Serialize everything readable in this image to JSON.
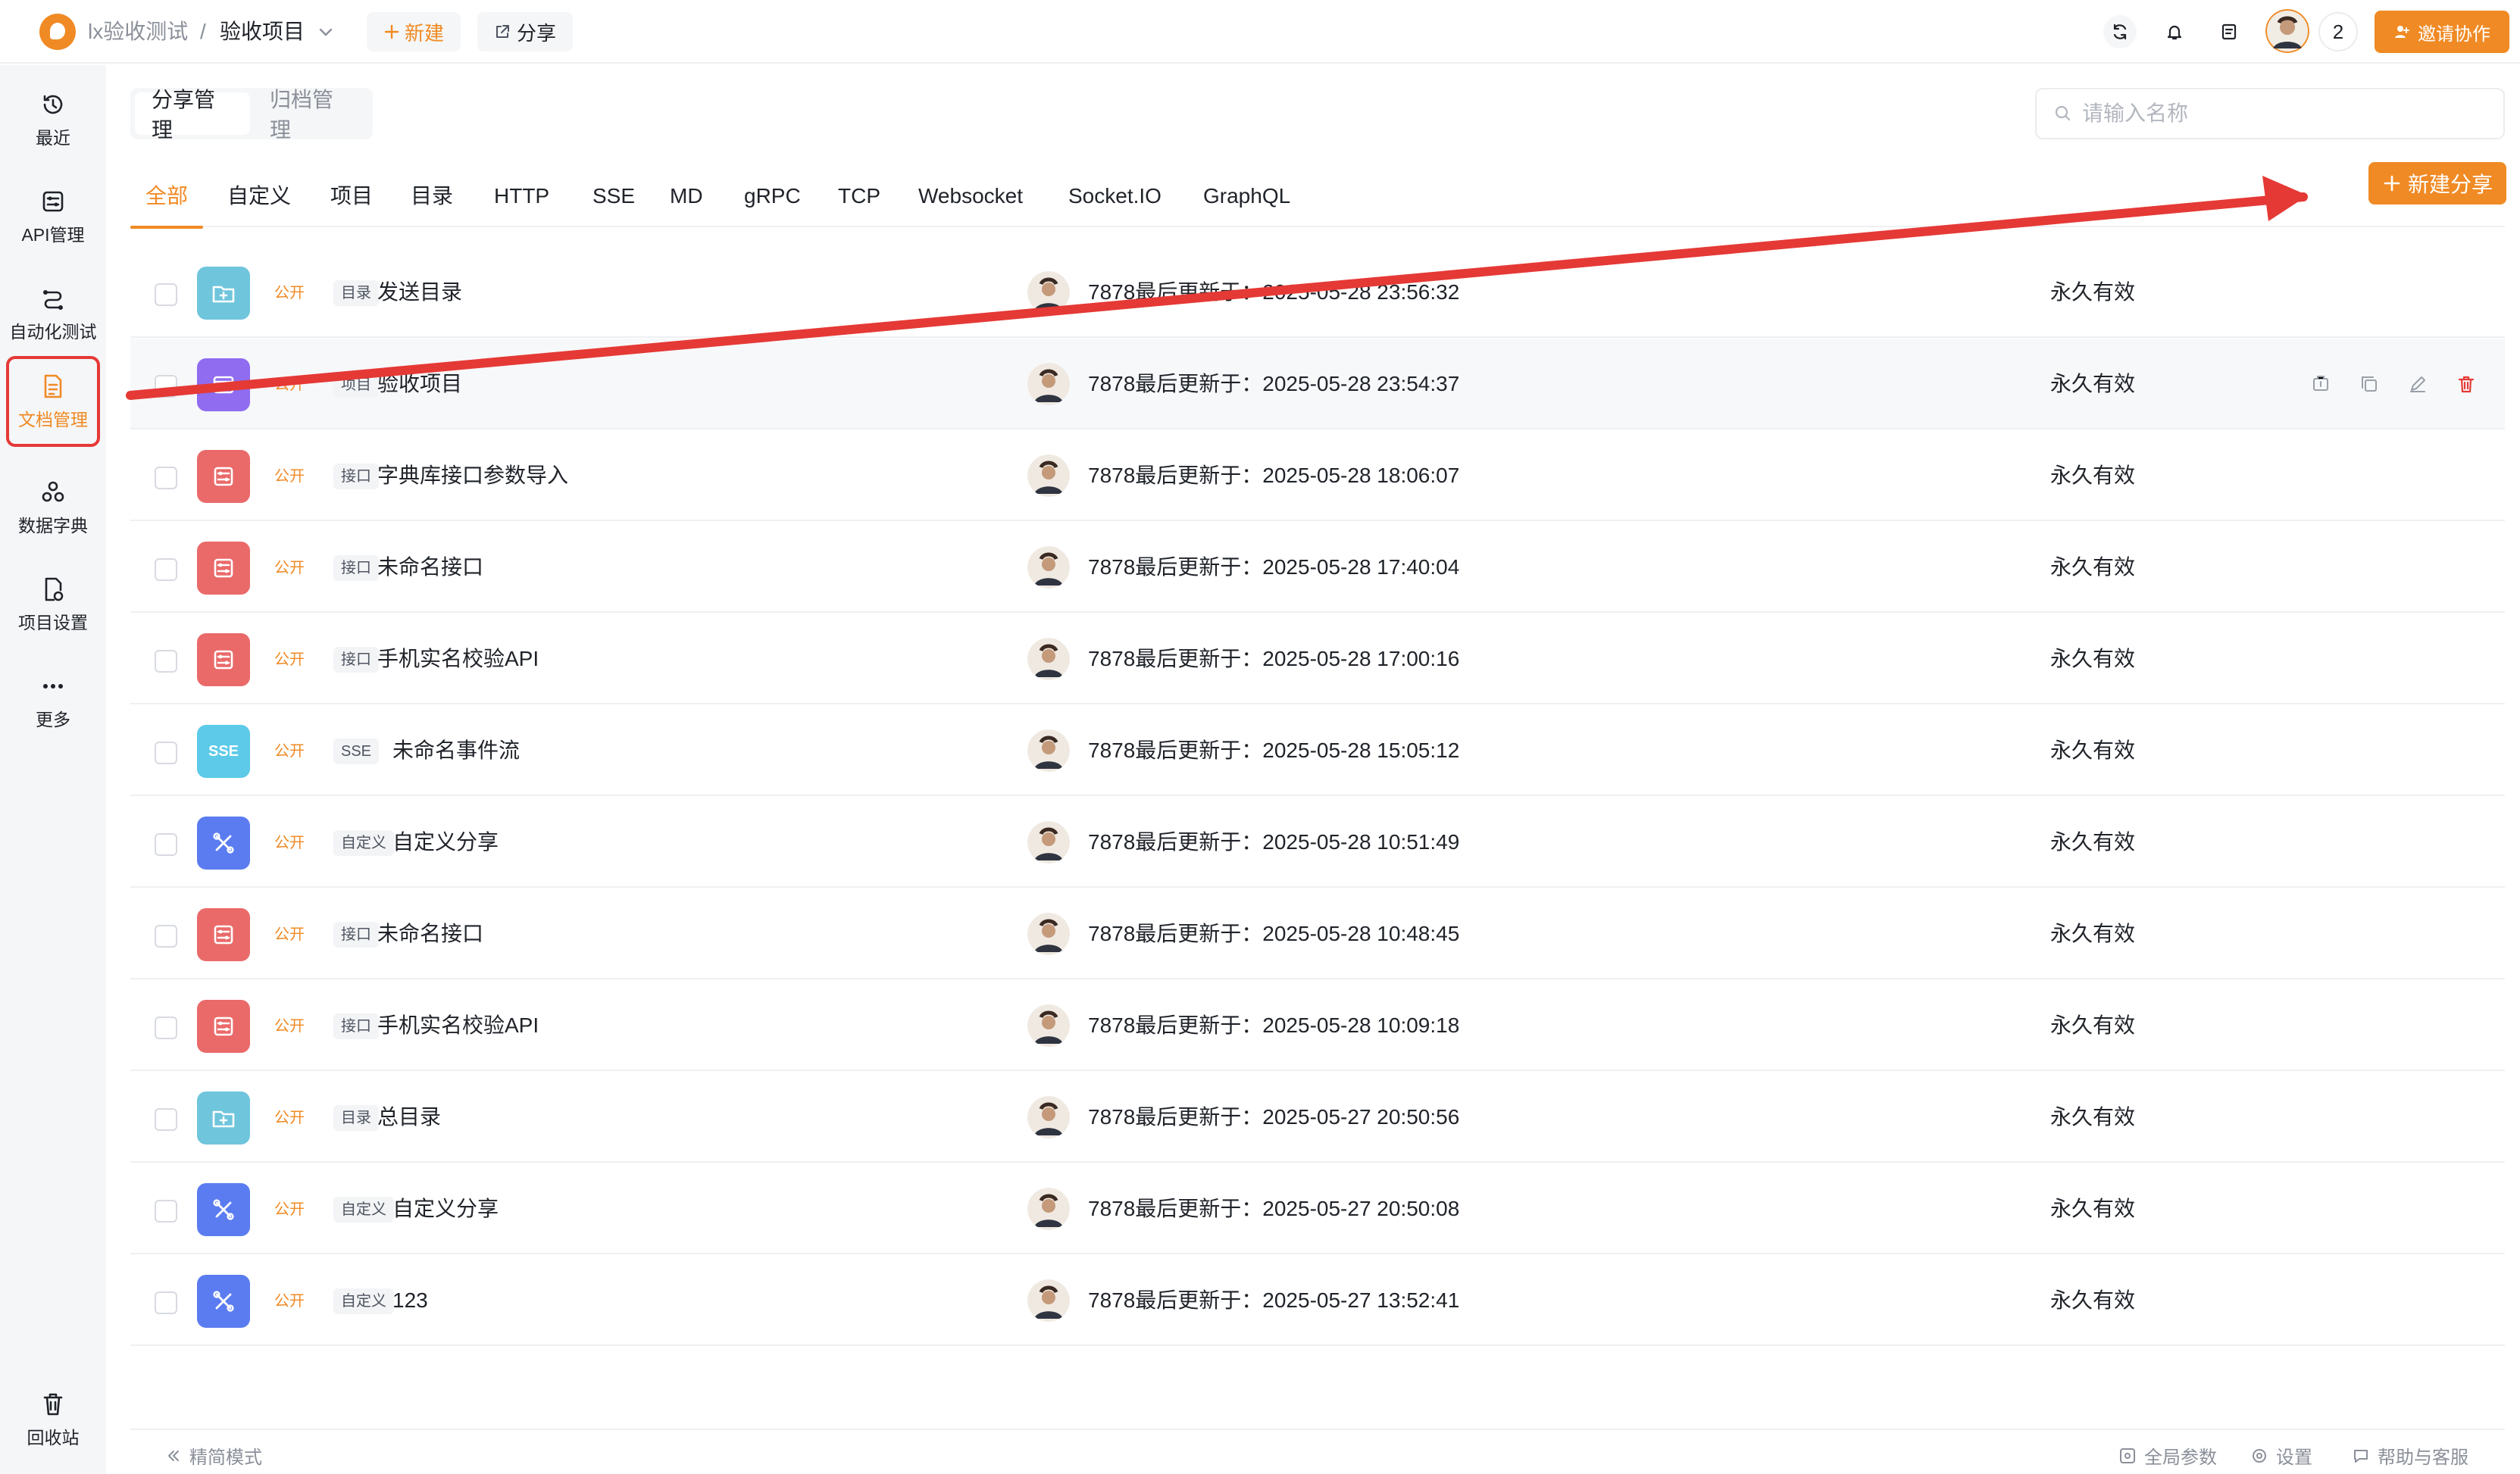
{
  "topbar": {
    "workspace": "lx验收测试",
    "separator": "/",
    "project": "验收项目",
    "new_label": "新建",
    "share_label": "分享",
    "member_count": "2",
    "invite_label": "邀请协作"
  },
  "sidebar": {
    "items": [
      {
        "label": "最近",
        "icon": "history-icon"
      },
      {
        "label": "API管理",
        "icon": "api-icon"
      },
      {
        "label": "自动化测试",
        "icon": "automation-icon"
      },
      {
        "label": "文档管理",
        "icon": "document-icon",
        "active": true
      },
      {
        "label": "数据字典",
        "icon": "dictionary-icon"
      },
      {
        "label": "项目设置",
        "icon": "project-settings-icon"
      },
      {
        "label": "更多",
        "icon": "more-icon"
      }
    ],
    "recycle_label": "回收站"
  },
  "segment": {
    "tabs": [
      "分享管理",
      "归档管理"
    ],
    "active": 0
  },
  "search": {
    "placeholder": "请输入名称",
    "value": ""
  },
  "filter_tabs": [
    "全部",
    "自定义",
    "项目",
    "目录",
    "HTTP",
    "SSE",
    "MD",
    "gRPC",
    "TCP",
    "Websocket",
    "Socket.IO",
    "GraphQL"
  ],
  "new_share_label": "新建分享",
  "shares": [
    {
      "icon": "folder-icon",
      "color": "#6fc5dc",
      "visibility": "公开",
      "type": "目录",
      "name": "发送目录",
      "meta": "7878最后更新于：2025-05-28 23:56:32",
      "validity": "永久有效"
    },
    {
      "icon": "project-icon",
      "color": "#8f6cf0",
      "visibility": "公开",
      "type": "项目",
      "name": "验收项目",
      "meta": "7878最后更新于：2025-05-28 23:54:37",
      "validity": "永久有效"
    },
    {
      "icon": "interface-icon",
      "color": "#ea6a6a",
      "visibility": "公开",
      "type": "接口",
      "name": "字典库接口参数导入",
      "meta": "7878最后更新于：2025-05-28 18:06:07",
      "validity": "永久有效"
    },
    {
      "icon": "interface-icon",
      "color": "#ea6a6a",
      "visibility": "公开",
      "type": "接口",
      "name": "未命名接口",
      "meta": "7878最后更新于：2025-05-28 17:40:04",
      "validity": "永久有效"
    },
    {
      "icon": "interface-icon",
      "color": "#ea6a6a",
      "visibility": "公开",
      "type": "接口",
      "name": "手机实名校验API",
      "meta": "7878最后更新于：2025-05-28 17:00:16",
      "validity": "永久有效"
    },
    {
      "icon": "sse-icon",
      "color": "#5ccae8",
      "visibility": "公开",
      "type": "SSE",
      "name": "未命名事件流",
      "meta": "7878最后更新于：2025-05-28 15:05:12",
      "validity": "永久有效"
    },
    {
      "icon": "custom-icon",
      "color": "#5b7cf0",
      "visibility": "公开",
      "type": "自定义",
      "name": "自定义分享",
      "meta": "7878最后更新于：2025-05-28 10:51:49",
      "validity": "永久有效"
    },
    {
      "icon": "interface-icon",
      "color": "#ea6a6a",
      "visibility": "公开",
      "type": "接口",
      "name": "未命名接口",
      "meta": "7878最后更新于：2025-05-28 10:48:45",
      "validity": "永久有效"
    },
    {
      "icon": "interface-icon",
      "color": "#ea6a6a",
      "visibility": "公开",
      "type": "接口",
      "name": "手机实名校验API",
      "meta": "7878最后更新于：2025-05-28 10:09:18",
      "validity": "永久有效"
    },
    {
      "icon": "folder-icon",
      "color": "#6fc5dc",
      "visibility": "公开",
      "type": "目录",
      "name": "总目录",
      "meta": "7878最后更新于：2025-05-27 20:50:56",
      "validity": "永久有效"
    },
    {
      "icon": "custom-icon",
      "color": "#5b7cf0",
      "visibility": "公开",
      "type": "自定义",
      "name": "自定义分享",
      "meta": "7878最后更新于：2025-05-27 20:50:08",
      "validity": "永久有效"
    },
    {
      "icon": "custom-icon",
      "color": "#5b7cf0",
      "visibility": "公开",
      "type": "自定义",
      "name": "123",
      "meta": "7878最后更新于：2025-05-27 13:52:41",
      "validity": "永久有效"
    }
  ],
  "sse_badge": "SSE",
  "footer": {
    "compact_mode": "精简模式",
    "global_params": "全局参数",
    "settings": "设置",
    "help": "帮助与客服"
  },
  "colors": {
    "accent": "#f08a24",
    "danger": "#e53935",
    "annotation": "#e53935"
  }
}
